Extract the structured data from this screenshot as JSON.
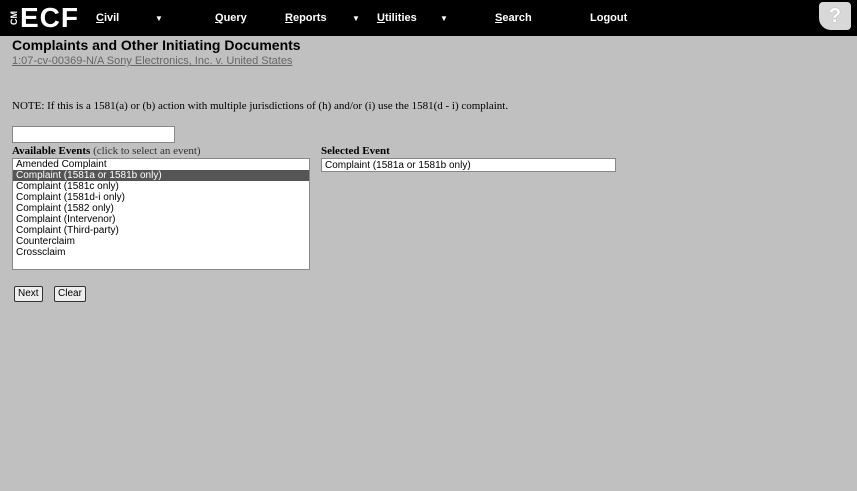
{
  "logo": {
    "cm": "CM",
    "ecf": "ECF"
  },
  "menu": [
    {
      "first": "C",
      "rest": "ivil"
    },
    {
      "first": "Q",
      "rest": "uery"
    },
    {
      "first": "R",
      "rest": "eports"
    },
    {
      "first": "U",
      "rest": "tilities"
    },
    {
      "first": "S",
      "rest": "earch"
    },
    {
      "first": "",
      "rest": "Logout"
    }
  ],
  "caret": "▼",
  "help": "?",
  "page": {
    "title": "Complaints and Other Initiating Documents",
    "case_link": "1:07-cv-00369-N/A Sony Electronics, Inc. v. United States",
    "note": "NOTE: If this is a 1581(a) or (b) action with multiple jurisdictions of (h) and/or (i) use the 1581(d - i) complaint."
  },
  "filter": {
    "value": ""
  },
  "available": {
    "label": "Available Events",
    "sub": " (click to select an event)",
    "items": [
      "Amended Complaint",
      "Complaint (1581a or 1581b only)",
      "Complaint (1581c only)",
      "Complaint (1581d-i only)",
      "Complaint (1582 only)",
      "Complaint (Intervenor)",
      "Complaint (Third-party)",
      "Counterclaim",
      "Crossclaim"
    ],
    "selected_index": 1
  },
  "selected": {
    "label": "Selected Event",
    "value": "Complaint (1581a or 1581b only)"
  },
  "buttons": {
    "next": "Next",
    "clear": "Clear"
  }
}
